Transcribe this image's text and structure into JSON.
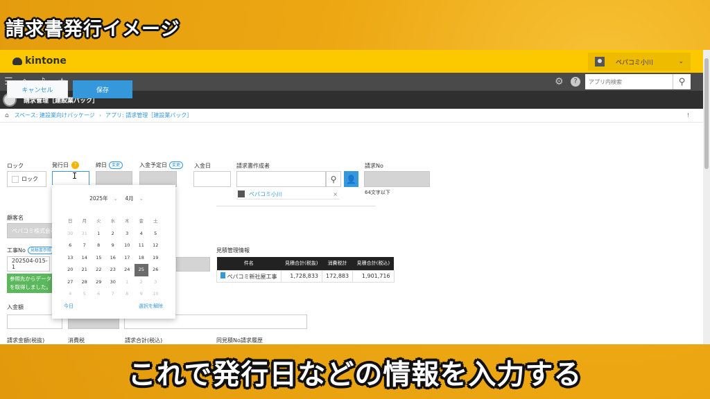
{
  "banner": {
    "title": "請求書発行イメージ"
  },
  "subtitle": "これで発行日などの情報を入力する",
  "kintone": {
    "logo": "kintone",
    "user": "ペパコミ小川",
    "search_placeholder": "アプリ内検索",
    "app_title": "請求管理［建設業パック］",
    "breadcrumb": [
      "スペース: 建設業向けパッケージ",
      "アプリ: 請求管理［建設業パック］"
    ],
    "nav_icons": [
      "menu-icon",
      "home-icon",
      "bell-icon",
      "star-icon"
    ],
    "settings_icons": [
      "gear-icon",
      "help-icon"
    ]
  },
  "actions": {
    "cancel": "キャンセル",
    "save": "保存"
  },
  "form": {
    "lock_label": "ロック",
    "lock_checkbox": "ロック",
    "issue_date_label": "発行日",
    "help_badge": "?",
    "close_date_label": "締日",
    "due_date_label": "入金予定日",
    "change_tag": "変更",
    "paid_date_label": "入金日",
    "creator_label": "請求書作成者",
    "creator_chip": "ペパコミ小川",
    "chip_close": "×",
    "invoice_no_label": "請求No",
    "invoice_no_hint": "64文字以下",
    "customer_label": "顧客名",
    "customer_value": "ペパコミ株式会社",
    "project_no_label": "工事No",
    "project_no_tag": "見積書参照",
    "project_no_value": "202504-015-1",
    "alert_text": "参照先からデータを取得しました。",
    "payment_label": "入金額",
    "bottom_labels": [
      "請求金額(税抜)",
      "消費税",
      "請求合計(税込)",
      "同見積No請求履歴"
    ]
  },
  "estimate": {
    "title": "見積管理情報",
    "headers": [
      "件名",
      "見積合計(税抜)",
      "消費税計",
      "見積合計(税込)"
    ],
    "row": {
      "name": "ペパコミ新社屋工事",
      "subtotal": "1,728,833",
      "tax": "172,883",
      "total": "1,901,716"
    }
  },
  "calendar": {
    "year": "2025年",
    "month": "4月",
    "weekdays": [
      "日",
      "月",
      "火",
      "水",
      "木",
      "金",
      "土"
    ],
    "days": [
      [
        "30",
        "31",
        "1",
        "2",
        "3",
        "4",
        "5"
      ],
      [
        "6",
        "7",
        "8",
        "9",
        "10",
        "11",
        "12"
      ],
      [
        "13",
        "14",
        "15",
        "16",
        "17",
        "18",
        "19"
      ],
      [
        "20",
        "21",
        "22",
        "23",
        "24",
        "25",
        "26"
      ],
      [
        "27",
        "28",
        "29",
        "30",
        "1",
        "2",
        "3"
      ],
      [
        "4",
        "5",
        "6",
        "7",
        "8",
        "9",
        "10"
      ]
    ],
    "selected": "25",
    "today": "今日",
    "clear": "選択を解除"
  }
}
